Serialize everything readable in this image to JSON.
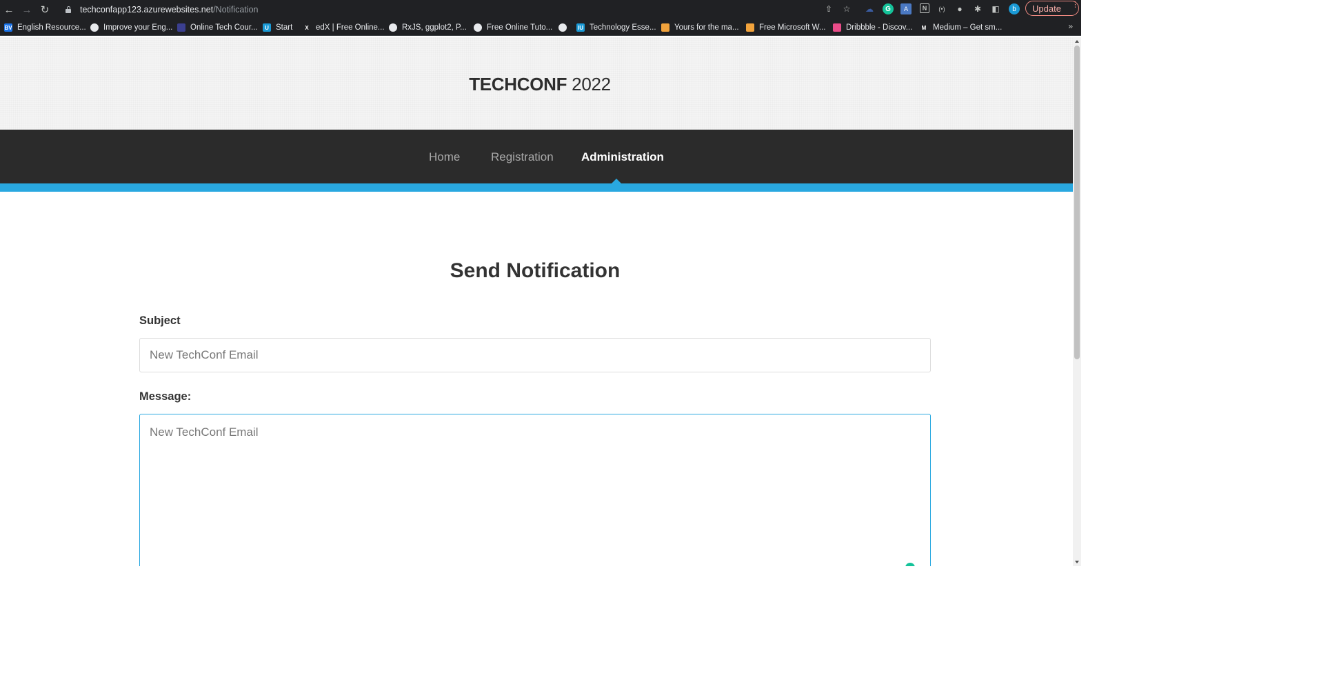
{
  "browser": {
    "url_host": "techconfapp123.azurewebsites.net",
    "url_path": "/Notification",
    "update_label": "Update",
    "profile_initial": "b",
    "bookmarks": [
      {
        "label": "English Resource...",
        "fav": "BV",
        "color": "#1a73e8"
      },
      {
        "label": "Improve your Eng...",
        "fav": "",
        "color": "#e8eaed"
      },
      {
        "label": "Online Tech Cour...",
        "fav": "",
        "color": "#3b3f8f"
      },
      {
        "label": "Start",
        "fav": "U",
        "color": "#1a9ad6"
      },
      {
        "label": "edX | Free Online...",
        "fav": "X",
        "color": "#202124"
      },
      {
        "label": "RxJS, ggplot2, P...",
        "fav": "",
        "color": "#e8eaed"
      },
      {
        "label": "Free Online Tuto...",
        "fav": "",
        "color": "#e8eaed"
      },
      {
        "label": "",
        "fav": "",
        "color": "#e8eaed"
      },
      {
        "label": "Technology Esse...",
        "fav": "IU",
        "color": "#1a9ad6"
      },
      {
        "label": "Yours for the ma...",
        "fav": "",
        "color": "#f2a33c"
      },
      {
        "label": "Free Microsoft W...",
        "fav": "",
        "color": "#f2a33c"
      },
      {
        "label": "Dribbble - Discov...",
        "fav": "",
        "color": "#ea4c89"
      },
      {
        "label": "Medium – Get sm...",
        "fav": "M",
        "color": "#202124"
      }
    ]
  },
  "site": {
    "brand_bold": "TECHCONF",
    "brand_year": "2022",
    "nav": [
      {
        "label": "Home",
        "active": false
      },
      {
        "label": "Registration",
        "active": false
      },
      {
        "label": "Administration",
        "active": true
      }
    ],
    "accent_color": "#29a8e0"
  },
  "form": {
    "title": "Send Notification",
    "subject_label": "Subject",
    "subject_placeholder": "New TechConf Email",
    "message_label": "Message:",
    "message_placeholder": "New TechConf Email"
  }
}
